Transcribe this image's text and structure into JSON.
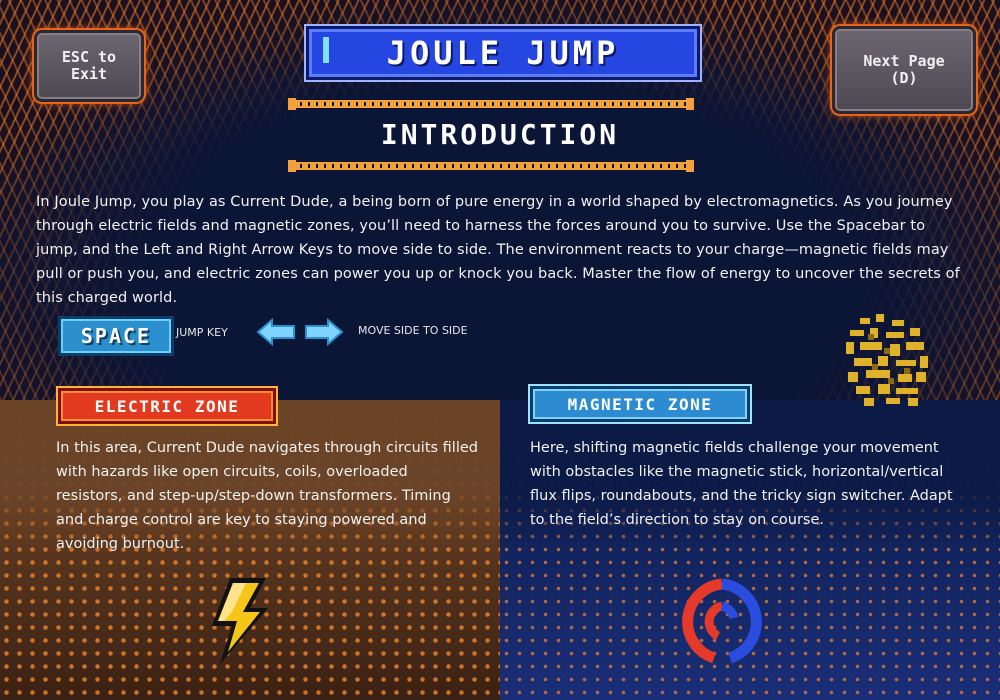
{
  "header": {
    "esc_label": "ESC to\nExit",
    "next_label": "Next Page\n(D)",
    "title": "JOULE JUMP",
    "section": "INTRODUCTION"
  },
  "intro": {
    "text": "In Joule Jump, you play as Current Dude, a being born of pure energy in a world shaped by electromagnetics. As you journey through electric fields and magnetic zones, you’ll need to harness the forces around you to survive. Use the Spacebar to jump, and the Left and Right Arrow Keys to move side to side. The environment reacts to your charge—magnetic fields may pull or push you, and electric zones can power you up or knock you back. Master the flow of energy to uncover the secrets of this charged world."
  },
  "controls": {
    "space_key": "SPACE",
    "jump_label": "JUMP KEY",
    "move_label": "MOVE SIDE TO SIDE"
  },
  "zones": {
    "electric": {
      "title": "ELECTRIC ZONE",
      "text": "In this area, Current Dude navigates through circuits filled with hazards like open circuits, coils, overloaded resistors, and step-up/step-down transformers. Timing and charge control are key to staying powered and avoiding burnout.",
      "icon": "lightning-bolt-icon"
    },
    "magnetic": {
      "title": "MAGNETIC ZONE",
      "text": "Here, shifting magnetic fields challenge your movement with obstacles like the magnetic stick, horizontal/vertical flux flips, roundabouts, and the tricky sign switcher. Adapt to the field’s direction to stay on course.",
      "icon": "magnet-icon"
    }
  },
  "colors": {
    "accent_orange": "#e8641a",
    "title_blue": "#2546e0",
    "electric_red": "#e13a1f",
    "magnetic_blue": "#2d8bd2",
    "bolt_yellow": "#f5c518"
  }
}
